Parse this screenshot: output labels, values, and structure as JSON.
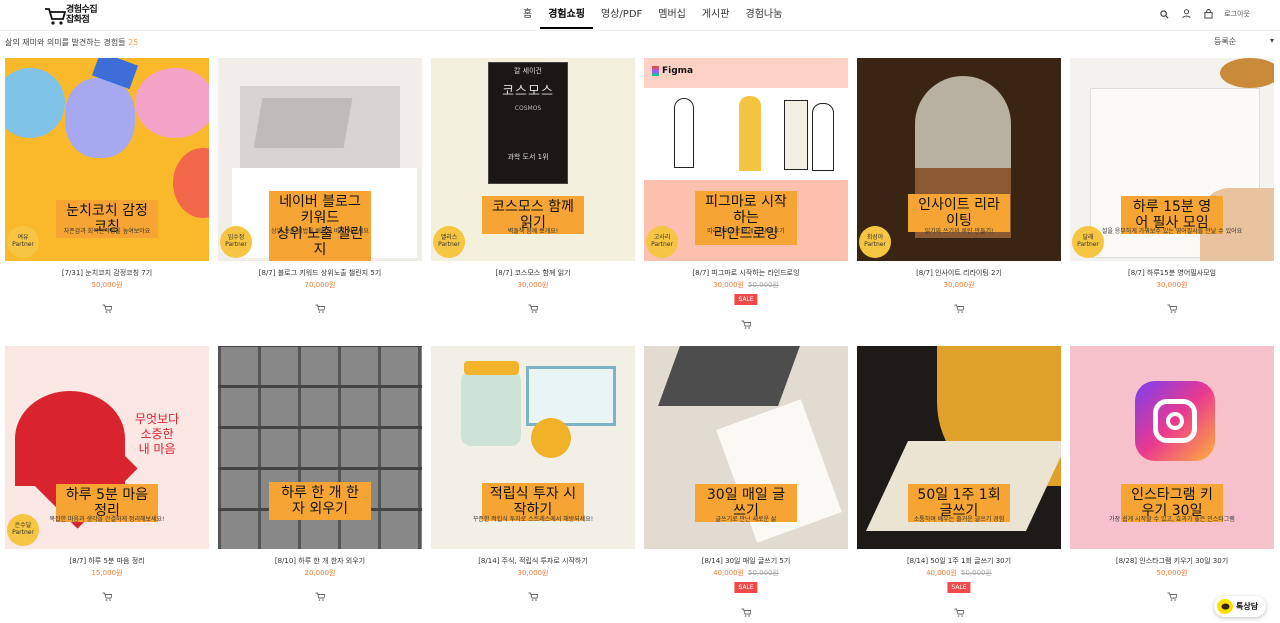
{
  "header": {
    "logo_line1": "경험수집",
    "logo_line2": "잡화점",
    "nav": [
      "홈",
      "경험쇼핑",
      "영상/PDF",
      "멤버십",
      "게시판",
      "경험나눔"
    ],
    "active_nav": "경험쇼핑",
    "login": "로그아웃",
    "icons": [
      "search-icon",
      "user-icon",
      "bag-icon"
    ]
  },
  "subbar": {
    "text": "삶의 재미와 의미를 발견하는 경험들",
    "count": "25",
    "sort": "등록순"
  },
  "products": [
    {
      "img_title": "눈치코치 감정코칭",
      "img_sub": "자존감과 회복탄력성을 높여보아요",
      "badge": "여유 Partner",
      "title": "[7/31] 눈치코치 감정코칭 7기",
      "price": "50,000원",
      "orig": "",
      "sale": ""
    },
    {
      "img_title": "네이버 블로그 키워드\n상위 노출 챌린지",
      "img_sub": "상위 노출 비법을 배워서 바로 써보세요",
      "badge": "임수정 Partner",
      "title": "[8/7] 블로그 키워드 상위노출 챌린지 5기",
      "price": "70,000원",
      "orig": "",
      "sale": ""
    },
    {
      "img_title": "코스모스 함께 읽기",
      "img_sub": "벽돌책 함께 뽀개요!",
      "badge": "앨리스 Partner",
      "title": "[8/7] 코스모스 함께 읽기",
      "price": "30,000원",
      "orig": "",
      "sale": "",
      "book": {
        "author": "칼 세이건",
        "title": "코스모스",
        "en": "COSMOS",
        "tag": "과학 도서 1위"
      }
    },
    {
      "img_title": "피그마로 시작하는\n라인드로잉",
      "img_sub": "따라그리기로 쉽게 그림 배우기",
      "badge": "고사리 Partner",
      "title": "[8/7] 피그마로 시작하는 라인드로잉",
      "price": "30,000원",
      "orig": "50,000원",
      "sale": "SALE",
      "brand": "Figma"
    },
    {
      "img_title": "인사이트 리라이팅",
      "img_sub": "읽기와 쓰기의 루틴 만들기!",
      "badge": "최성아 Partner",
      "title": "[8/7] 인사이트 리라이팅 2기",
      "price": "30,000원",
      "orig": "",
      "sale": ""
    },
    {
      "img_title": "하루 15분 영어 필사 모임",
      "img_sub": "설을 응부하게 가꿔보수 있는 영어필사를 만날 수 있어요",
      "badge": "달래 Partner",
      "title": "[8/7] 하루15분 영어필사모임",
      "price": "30,000원",
      "orig": "",
      "sale": ""
    },
    {
      "img_title": "하루 5분 마음 정리",
      "img_sub": "복잡한 마음과 생각을 간결하게 정리해보세요!",
      "badge": "은수달 Partner",
      "title": "[8/7] 하루 5분 마음 정리",
      "price": "15,000원",
      "orig": "",
      "sale": "",
      "heart": "무엇보다\n소중한\n내 마음"
    },
    {
      "img_title": "하루 한 개 한자 외우기",
      "img_sub": "",
      "badge": "",
      "title": "[8/10] 하루 한 개 한자 외우기",
      "price": "20,000원",
      "orig": "",
      "sale": ""
    },
    {
      "img_title": "적립식 투자 시작하기",
      "img_sub": "꾸준한 적립식 투자로 스트레스에서 해방되세요!",
      "badge": "",
      "title": "[8/14] 주식, 적립식 투자로 시작하기",
      "price": "30,000원",
      "orig": "",
      "sale": ""
    },
    {
      "img_title": "30일 매일 글쓰기",
      "img_sub": "글쓰기로 만난 새로운 삶",
      "badge": "",
      "title": "[8/14] 30일 매일 글쓰기 5기",
      "price": "40,000원",
      "orig": "50,000원",
      "sale": "SALE"
    },
    {
      "img_title": "50일 1주 1회 글쓰기",
      "img_sub": "소통하며 배우는 즐거운 글쓰기 경험",
      "badge": "",
      "title": "[8/14] 50일 1주 1회 글쓰기 30기",
      "price": "40,000원",
      "orig": "50,000원",
      "sale": "SALE"
    },
    {
      "img_title": "인스타그램 키우기 30일",
      "img_sub": "가장 쉽게 시작할 수 있고, 효과가 좋은 인스타그램",
      "badge": "",
      "title": "[8/28] 인스타그램 키우기 30일 30기",
      "price": "50,000원",
      "orig": "",
      "sale": ""
    }
  ],
  "talk": {
    "label": "톡상담"
  }
}
